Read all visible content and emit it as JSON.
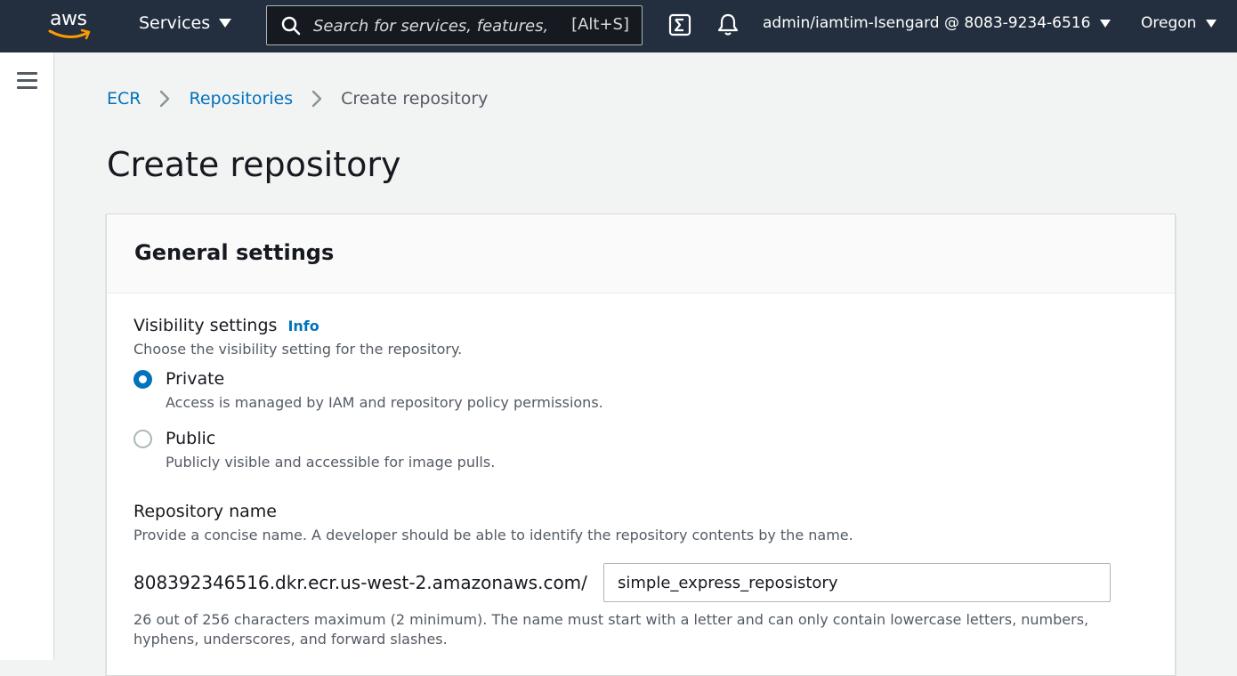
{
  "topnav": {
    "logo_text": "aws",
    "services_label": "Services",
    "search_placeholder": "Search for services, features, marketplace products, and docs",
    "search_shortcut": "[Alt+S]",
    "account_label": "admin/iamtim-Isengard @ 8083-9234-6516",
    "region_label": "Oregon",
    "colors": {
      "background": "#232f3e",
      "search_background": "#16191f"
    }
  },
  "icons": {
    "search": "search-icon",
    "cloudshell": "cloudshell-icon",
    "notifications": "bell-icon",
    "menu": "hamburger-icon",
    "breadcrumb_separator": "chevron-right-icon"
  },
  "breadcrumb": {
    "items": [
      "ECR",
      "Repositories"
    ],
    "current": "Create repository"
  },
  "page": {
    "title": "Create repository"
  },
  "general_settings": {
    "title": "General settings",
    "visibility": {
      "label": "Visibility settings",
      "info_label": "Info",
      "description": "Choose the visibility setting for the repository.",
      "selected": "Private",
      "options": [
        {
          "label": "Private",
          "description": "Access is managed by IAM and repository policy permissions."
        },
        {
          "label": "Public",
          "description": "Publicly visible and accessible for image pulls."
        }
      ]
    },
    "repository_name": {
      "label": "Repository name",
      "description": "Provide a concise name. A developer should be able to identify the repository contents by the name.",
      "uri_prefix": "808392346516.dkr.ecr.us-west-2.amazonaws.com/",
      "value": "simple_express_reposistory",
      "constraint": "26 out of 256 characters maximum (2 minimum). The name must start with a letter and can only contain lowercase letters, numbers, hyphens, underscores, and forward slashes."
    }
  },
  "colors": {
    "accent": "#0073bb",
    "text": "#16191f",
    "muted": "#545b64",
    "background": "#f2f3f3"
  }
}
